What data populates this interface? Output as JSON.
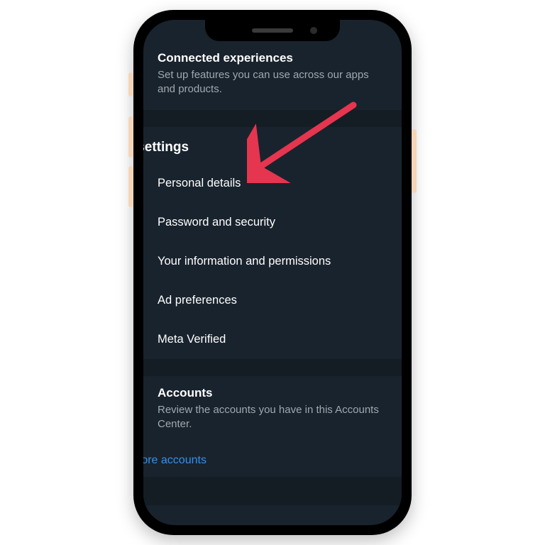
{
  "connected": {
    "title": "Connected experiences",
    "desc": "Set up features you can use across our apps and products."
  },
  "settings_header": "nt settings",
  "items": [
    {
      "label": "Personal details"
    },
    {
      "label": "Password and security"
    },
    {
      "label": "Your information and permissions"
    },
    {
      "label": "Ad preferences"
    },
    {
      "label": "Meta Verified"
    }
  ],
  "accounts": {
    "title": "Accounts",
    "desc": "Review the accounts you have in this Accounts Center.",
    "more_link": "more accounts"
  },
  "arrow_color": "#e6354f"
}
